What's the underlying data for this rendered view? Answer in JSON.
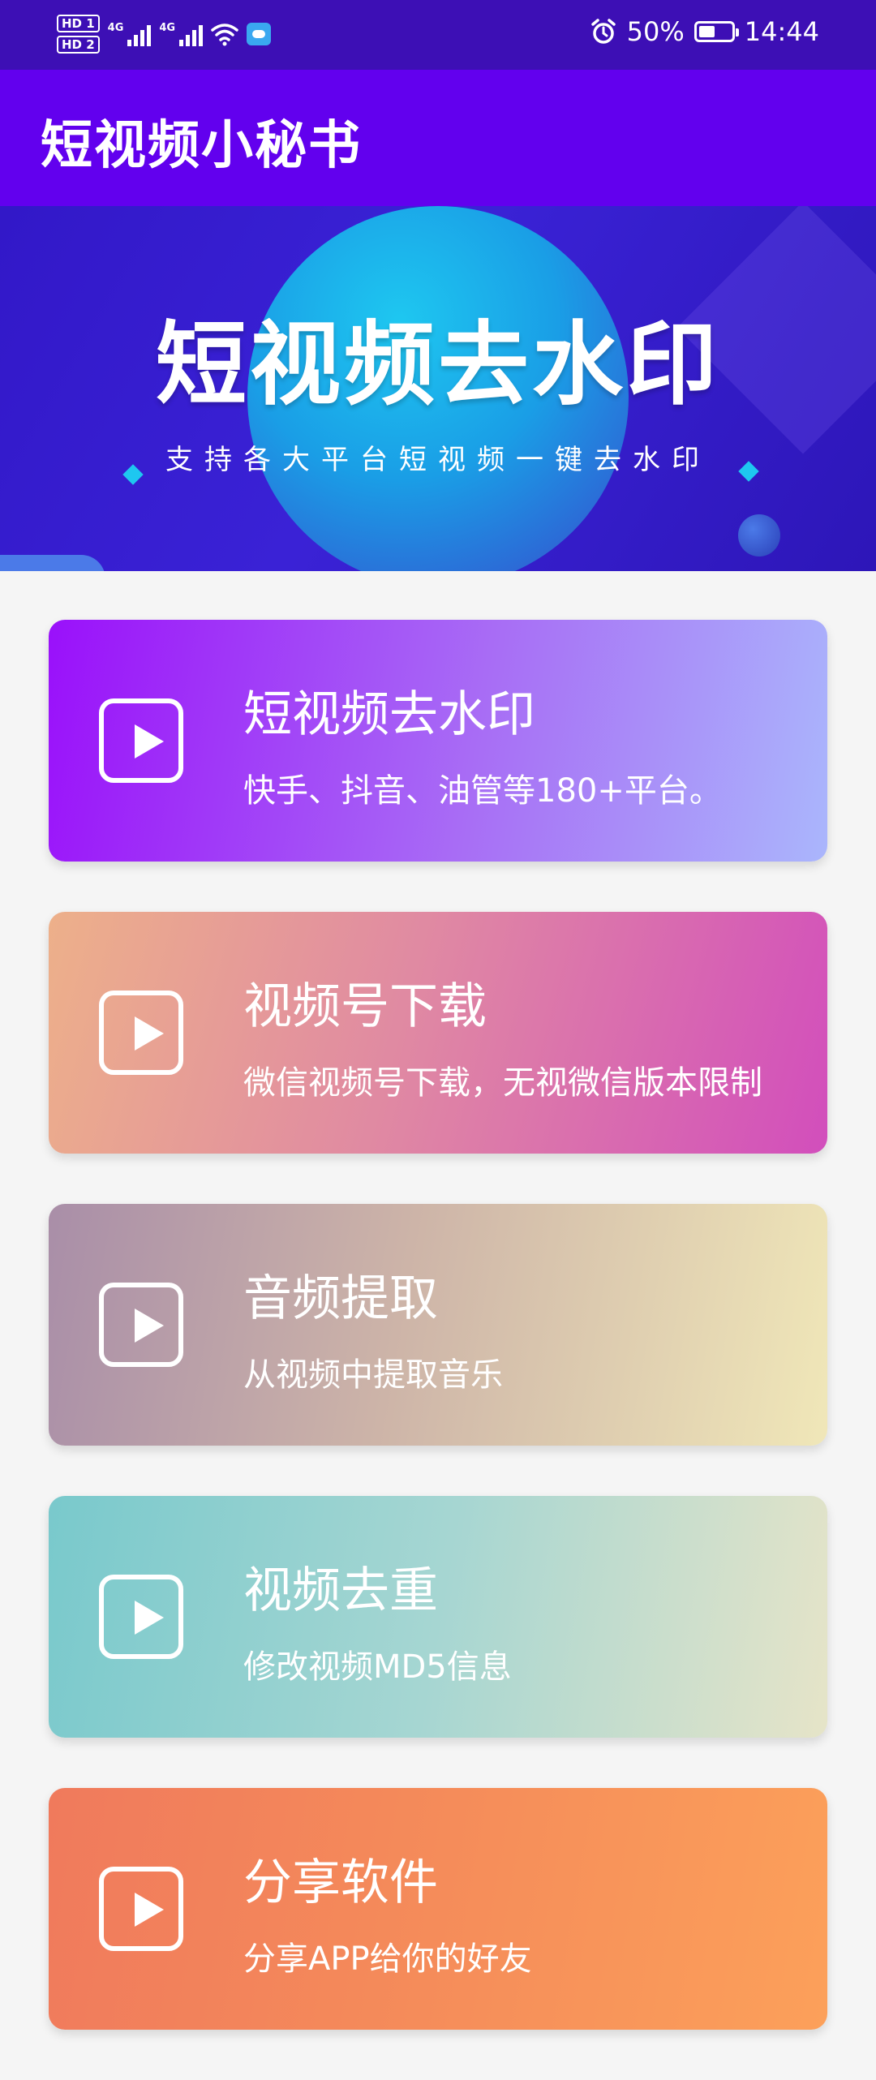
{
  "status_bar": {
    "hd1": "HD 1",
    "hd2": "HD 2",
    "net1": "4G",
    "net2": "4G",
    "battery_percent": "50%",
    "battery_level": 0.5,
    "time": "14:44"
  },
  "app_bar": {
    "title": "短视频小秘书"
  },
  "banner": {
    "title": "短视频去水印",
    "subtitle": "支持各大平台短视频一键去水印"
  },
  "cards": [
    {
      "title": "短视频去水印",
      "desc": "快手、抖音、油管等180+平台。"
    },
    {
      "title": "视频号下载",
      "desc": "微信视频号下载，无视微信版本限制"
    },
    {
      "title": "音频提取",
      "desc": "从视频中提取音乐"
    },
    {
      "title": "视频去重",
      "desc": "修改视频MD5信息"
    },
    {
      "title": "分享软件",
      "desc": "分享APP给你的好友"
    }
  ],
  "icons": {
    "play": "play-icon",
    "alarm": "alarm-icon",
    "wifi": "wifi-icon",
    "cloud": "cloud-icon",
    "battery": "battery-icon"
  },
  "colors": {
    "status_bar": "#3d0fb5",
    "app_bar": "#6200ee",
    "background": "#f5f5f5"
  }
}
